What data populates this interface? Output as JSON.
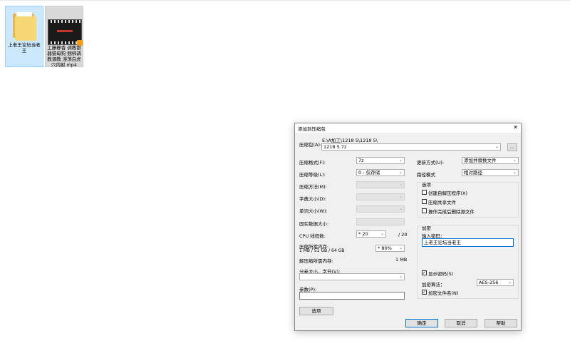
{
  "desktop": {
    "items": [
      {
        "label": "上老王论坛当老王",
        "type": "folder"
      },
      {
        "label": "工藤静香 调教银器猫母狗 捆绑调教调教 淫荡白虎穴内射.mp4",
        "type": "video"
      }
    ]
  },
  "dialog": {
    "title": "添加到压缩包",
    "close": "✕",
    "archive_label": "压缩包(A):",
    "archive_dir": "E:\\A加工\\1218 5\\1218 5\\",
    "archive_name": "1218 5.7z",
    "browse": "...",
    "left": {
      "format_label": "压缩格式(F):",
      "format_value": "7z",
      "level_label": "压缩等级(L):",
      "level_value": "0 - 仅存储",
      "method_label": "压缩方法(M):",
      "dict_label": "字典大小(D):",
      "word_label": "单词大小(W):",
      "solid_label": "固实数据大小:",
      "cpu_label": "CPU 线程数:",
      "cpu_value": "* 20",
      "cpu_total": "/ 20",
      "mem_label": "压缩所需内存:",
      "mem_detail": "1 MB / 51 GB / 64 GB",
      "mem_percent": "* 80%",
      "decomp_label": "解压缩所需内存:",
      "decomp_value": "1 MB",
      "split_label": "分卷大小，字节(V):",
      "params_label": "参数(P):",
      "options_button": "选项"
    },
    "right": {
      "update_label": "更新方式(U):",
      "update_value": "添加并替换文件",
      "path_label": "路径模式",
      "path_value": "相对路径",
      "options_title": "选项",
      "opt_sfx": "创建自解压程序(X)",
      "opt_shared": "压缩共享文件",
      "opt_delete": "操作完成后删除源文件",
      "encrypt_title": "加密",
      "pwd_label": "输入密码：",
      "pwd_value": "上老王论坛当老王",
      "show_pwd": "显示密码(S)",
      "enc_method_label": "加密算法：",
      "enc_method_value": "AES-256",
      "enc_names": "加密文件名(N)"
    },
    "buttons": {
      "ok": "确定",
      "cancel": "取消",
      "help": "帮助"
    }
  },
  "checks": {
    "checked": "✓"
  },
  "colors": {
    "accent": "#0078d7",
    "selection": "#cce8ff"
  }
}
